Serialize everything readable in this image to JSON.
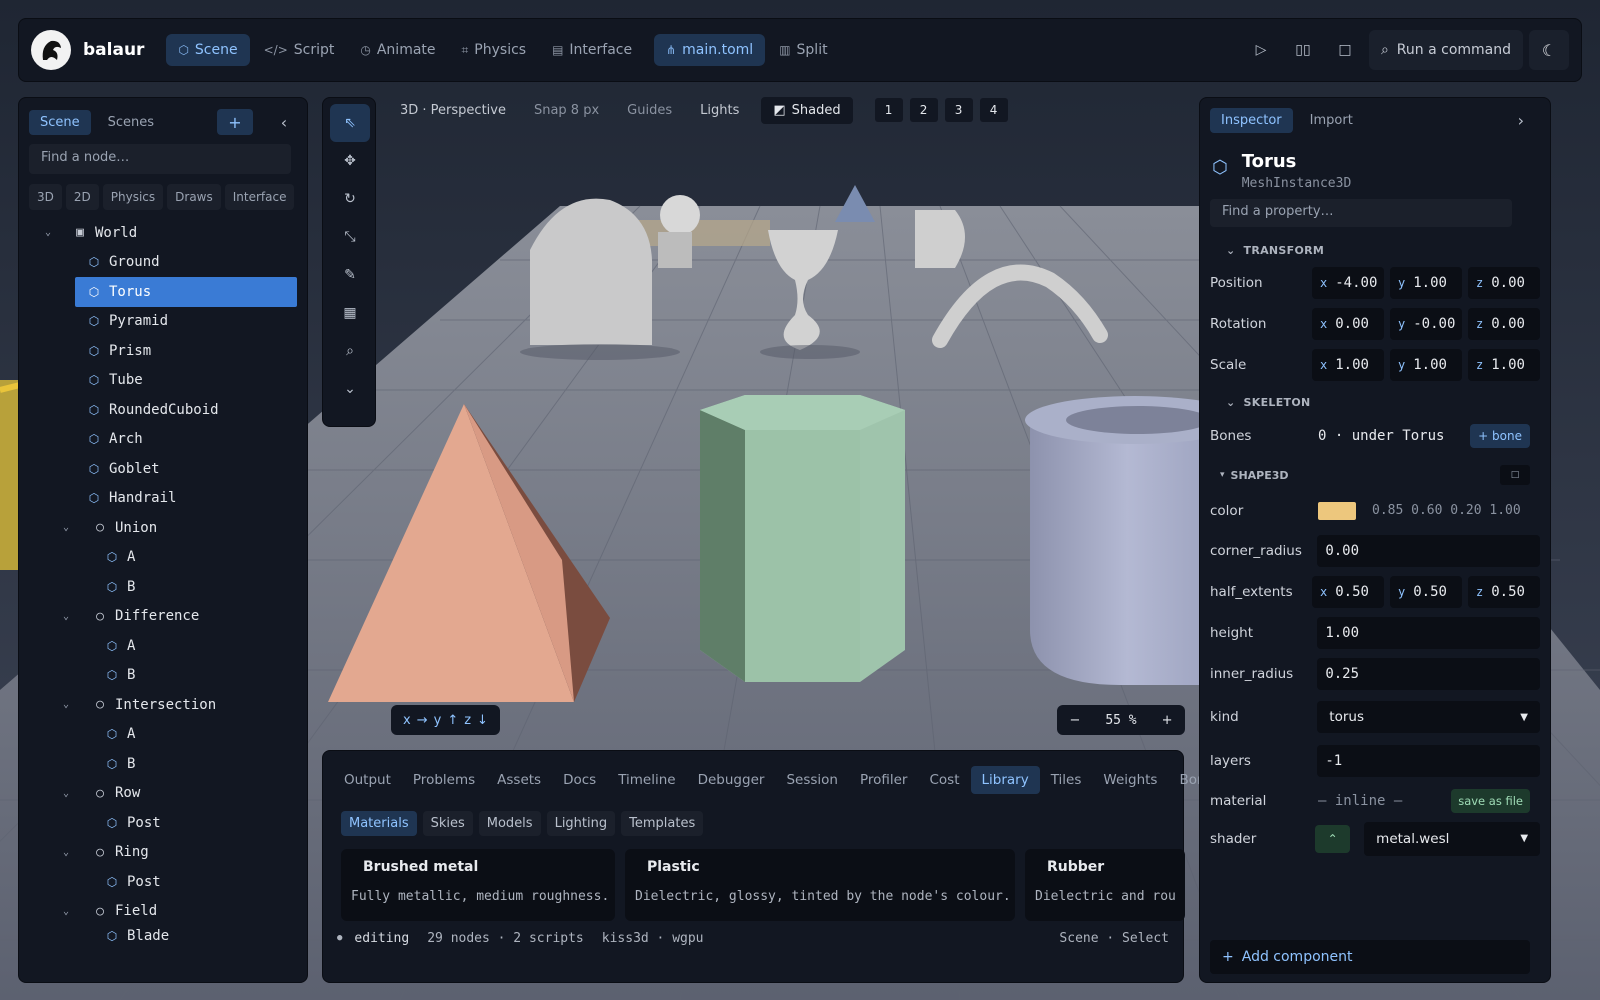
{
  "colors": {
    "accent": "#8fc3ff",
    "selection": "#3a7bd5",
    "panel": "#121722",
    "swatch": "#d9996"
  },
  "topbar": {
    "brand": "balaur",
    "tabs": [
      {
        "label": "Scene",
        "icon": "cube-icon"
      },
      {
        "label": "Script",
        "icon": "code-icon"
      },
      {
        "label": "Animate",
        "icon": "clock-icon"
      },
      {
        "label": "Physics",
        "icon": "physics-icon"
      },
      {
        "label": "Interface",
        "icon": "layout-icon"
      }
    ],
    "file_label": "main.toml",
    "split_label": "Split",
    "command_label": "Run a command"
  },
  "scene_panel": {
    "tabs": [
      "Scene",
      "Scenes"
    ],
    "search_placeholder": "Find a node…",
    "filters": [
      "3D",
      "2D",
      "Physics",
      "Draws",
      "Interface"
    ],
    "tree": [
      {
        "label": "World"
      },
      {
        "label": "Ground"
      },
      {
        "label": "Torus"
      },
      {
        "label": "Pyramid"
      },
      {
        "label": "Prism"
      },
      {
        "label": "Tube"
      },
      {
        "label": "RoundedCuboid"
      },
      {
        "label": "Arch"
      },
      {
        "label": "Goblet"
      },
      {
        "label": "Handrail"
      },
      {
        "label": "Union"
      },
      {
        "label": "A"
      },
      {
        "label": "B"
      },
      {
        "label": "Difference"
      },
      {
        "label": "A"
      },
      {
        "label": "B"
      },
      {
        "label": "Intersection"
      },
      {
        "label": "A"
      },
      {
        "label": "B"
      },
      {
        "label": "Row"
      },
      {
        "label": "Post"
      },
      {
        "label": "Ring"
      },
      {
        "label": "Post"
      },
      {
        "label": "Field"
      },
      {
        "label": "Blade"
      }
    ]
  },
  "viewport": {
    "mode": "3D · Perspective",
    "snap": "Snap 8 px",
    "guides": "Guides",
    "lights": "Lights",
    "shading": "Shaded",
    "views": [
      "1",
      "2",
      "3",
      "4"
    ],
    "axes": [
      "x",
      "→",
      "y",
      "↑",
      "z",
      "↓"
    ],
    "zoom": "55 %"
  },
  "bottom_panel": {
    "tabs": [
      "Output",
      "Problems",
      "Assets",
      "Docs",
      "Timeline",
      "Debugger",
      "Session",
      "Profiler",
      "Cost",
      "Library",
      "Tiles",
      "Weights",
      "Bone"
    ],
    "library_tabs": [
      "Materials",
      "Skies",
      "Models",
      "Lighting",
      "Templates"
    ],
    "cards": [
      {
        "title": "Brushed metal",
        "desc": "Fully metallic, medium roughness."
      },
      {
        "title": "Plastic",
        "desc": "Dielectric, glossy, tinted by the node's colour."
      },
      {
        "title": "Rubber",
        "desc": "Dielectric and rou"
      }
    ],
    "status": {
      "dot": "●",
      "state": "editing",
      "counts": "29 nodes · 2 scripts",
      "engine": "kiss3d · wgpu",
      "context": "Scene · Select"
    }
  },
  "inspector": {
    "tabs": [
      "Inspector",
      "Import"
    ],
    "node_name": "Torus",
    "node_type": "MeshInstance3D",
    "search_placeholder": "Find a property…",
    "transform_heading": "TRANSFORM",
    "position": {
      "label": "Position",
      "x": "-4.00",
      "y": "1.00",
      "z": "0.00"
    },
    "rotation": {
      "label": "Rotation",
      "x": "0.00",
      "y": "-0.00",
      "z": "0.00"
    },
    "scale": {
      "label": "Scale",
      "x": "1.00",
      "y": "1.00",
      "z": "1.00"
    },
    "skeleton_heading": "SKELETON",
    "bones": {
      "label": "Bones",
      "value": "0 · under Torus",
      "button": "+ bone"
    },
    "shape_heading": "SHAPE3D",
    "color": {
      "label": "color",
      "value": "0.85 0.60 0.20 1.00",
      "swatch": "#edc77d"
    },
    "corner_radius": {
      "label": "corner_radius",
      "value": "0.00"
    },
    "half_extents": {
      "label": "half_extents",
      "x": "0.50",
      "y": "0.50",
      "z": "0.50"
    },
    "height": {
      "label": "height",
      "value": "1.00"
    },
    "inner_radius": {
      "label": "inner_radius",
      "value": "0.25"
    },
    "kind": {
      "label": "kind",
      "value": "torus"
    },
    "layers": {
      "label": "layers",
      "value": "-1"
    },
    "material": {
      "label": "material",
      "value": "— inline —",
      "button": "save as file"
    },
    "shader": {
      "label": "shader",
      "value": "metal.wesl"
    },
    "add_component": "Add component",
    "axis_x": "x",
    "axis_y": "y",
    "axis_z": "z"
  }
}
